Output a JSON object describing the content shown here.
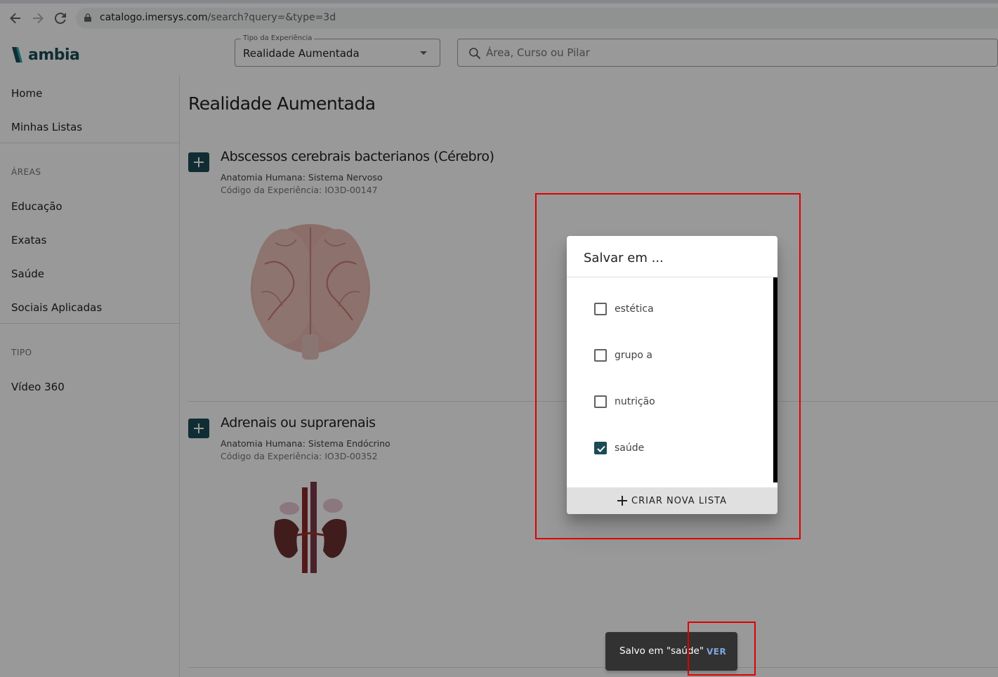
{
  "browser": {
    "url_host": "catalogo.imersys.com",
    "url_path": "/search?query=&type=3d"
  },
  "brand": {
    "name": "ambia",
    "color": "#1b4b55"
  },
  "header": {
    "type_select": {
      "label": "Tipo da Experiência",
      "value": "Realidade Aumentada"
    },
    "search": {
      "placeholder": "Área, Curso ou Pilar",
      "value": ""
    }
  },
  "sidebar": {
    "top_items": [
      {
        "label": "Home"
      },
      {
        "label": "Minhas Listas"
      }
    ],
    "areas_heading": "ÁREAS",
    "areas": [
      {
        "label": "Educação"
      },
      {
        "label": "Exatas"
      },
      {
        "label": "Saúde"
      },
      {
        "label": "Sociais Aplicadas"
      }
    ],
    "tipo_heading": "TIPO",
    "tipos": [
      {
        "label": "Vídeo 360"
      }
    ]
  },
  "main": {
    "title": "Realidade Aumentada",
    "cards": [
      {
        "title": "Abscessos cerebrais bacterianos (Cérebro)",
        "subtitle": "Anatomia Humana: Sistema Nervoso",
        "code": "Código da Experiência: IO3D-00147",
        "image": "brain-model"
      },
      {
        "title": "Adrenais ou suprarenais",
        "subtitle": "Anatomia Humana: Sistema Endócrino",
        "code": "Código da Experiência: IO3D-00352",
        "image": "kidneys-adrenals-model"
      }
    ]
  },
  "dialog": {
    "title": "Salvar em ...",
    "options": [
      {
        "label": "estética",
        "checked": false
      },
      {
        "label": "grupo a",
        "checked": false
      },
      {
        "label": "nutrição",
        "checked": false
      },
      {
        "label": "saúde",
        "checked": true
      }
    ],
    "create_label": "CRIAR NOVA LISTA"
  },
  "snackbar": {
    "message": "Salvo em \"saúde\"",
    "action": "VER"
  },
  "colors": {
    "annotation": "#e00000",
    "checkbox_checked": "#1b4b55",
    "snackbar_action": "#7ea7e0"
  }
}
